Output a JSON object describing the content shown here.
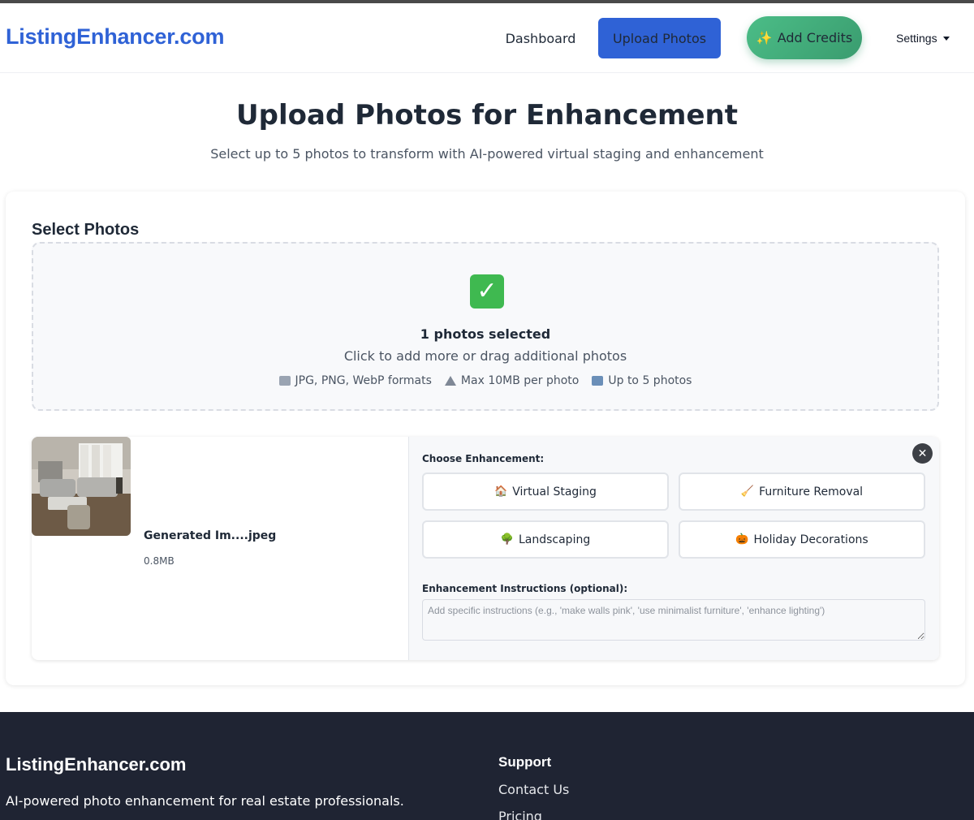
{
  "header": {
    "logo": "ListingEnhancer.com",
    "nav": {
      "dashboard": "Dashboard",
      "upload": "Upload Photos",
      "credits_icon": "✨",
      "credits": "Add Credits",
      "settings": "Settings"
    }
  },
  "hero": {
    "title": "Upload Photos for Enhancement",
    "subtitle": "Select up to 5 photos to transform with AI-powered virtual staging and enhancement"
  },
  "upload": {
    "section_title": "Select Photos",
    "dropzone": {
      "icon": "check-mark-icon",
      "selected": "1 photos selected",
      "hint": "Click to add more or drag additional photos",
      "formats": "JPG, PNG, WebP formats",
      "max_size": "Max 10MB per photo",
      "limit": "Up to 5 photos"
    },
    "file": {
      "name": "Generated Im....jpeg",
      "size": "0.8MB"
    },
    "options": {
      "label": "Choose Enhancement:",
      "buttons": [
        {
          "icon": "🏠",
          "label": "Virtual Staging"
        },
        {
          "icon": "🧹",
          "label": "Furniture Removal"
        },
        {
          "icon": "🌳",
          "label": "Landscaping"
        },
        {
          "icon": "🎃",
          "label": "Holiday Decorations"
        }
      ],
      "instructions_label": "Enhancement Instructions (optional):",
      "instructions_placeholder": "Add specific instructions (e.g., 'make walls pink', 'use minimalist furniture', 'enhance lighting')"
    }
  },
  "footer": {
    "logo": "ListingEnhancer.com",
    "tagline": "AI-powered photo enhancement for real estate professionals.",
    "support_title": "Support",
    "links": [
      "Contact Us",
      "Pricing"
    ]
  },
  "colors": {
    "brand": "#2f62d6",
    "credits_green": "#4bbd87",
    "footer_bg": "#1f2433"
  }
}
